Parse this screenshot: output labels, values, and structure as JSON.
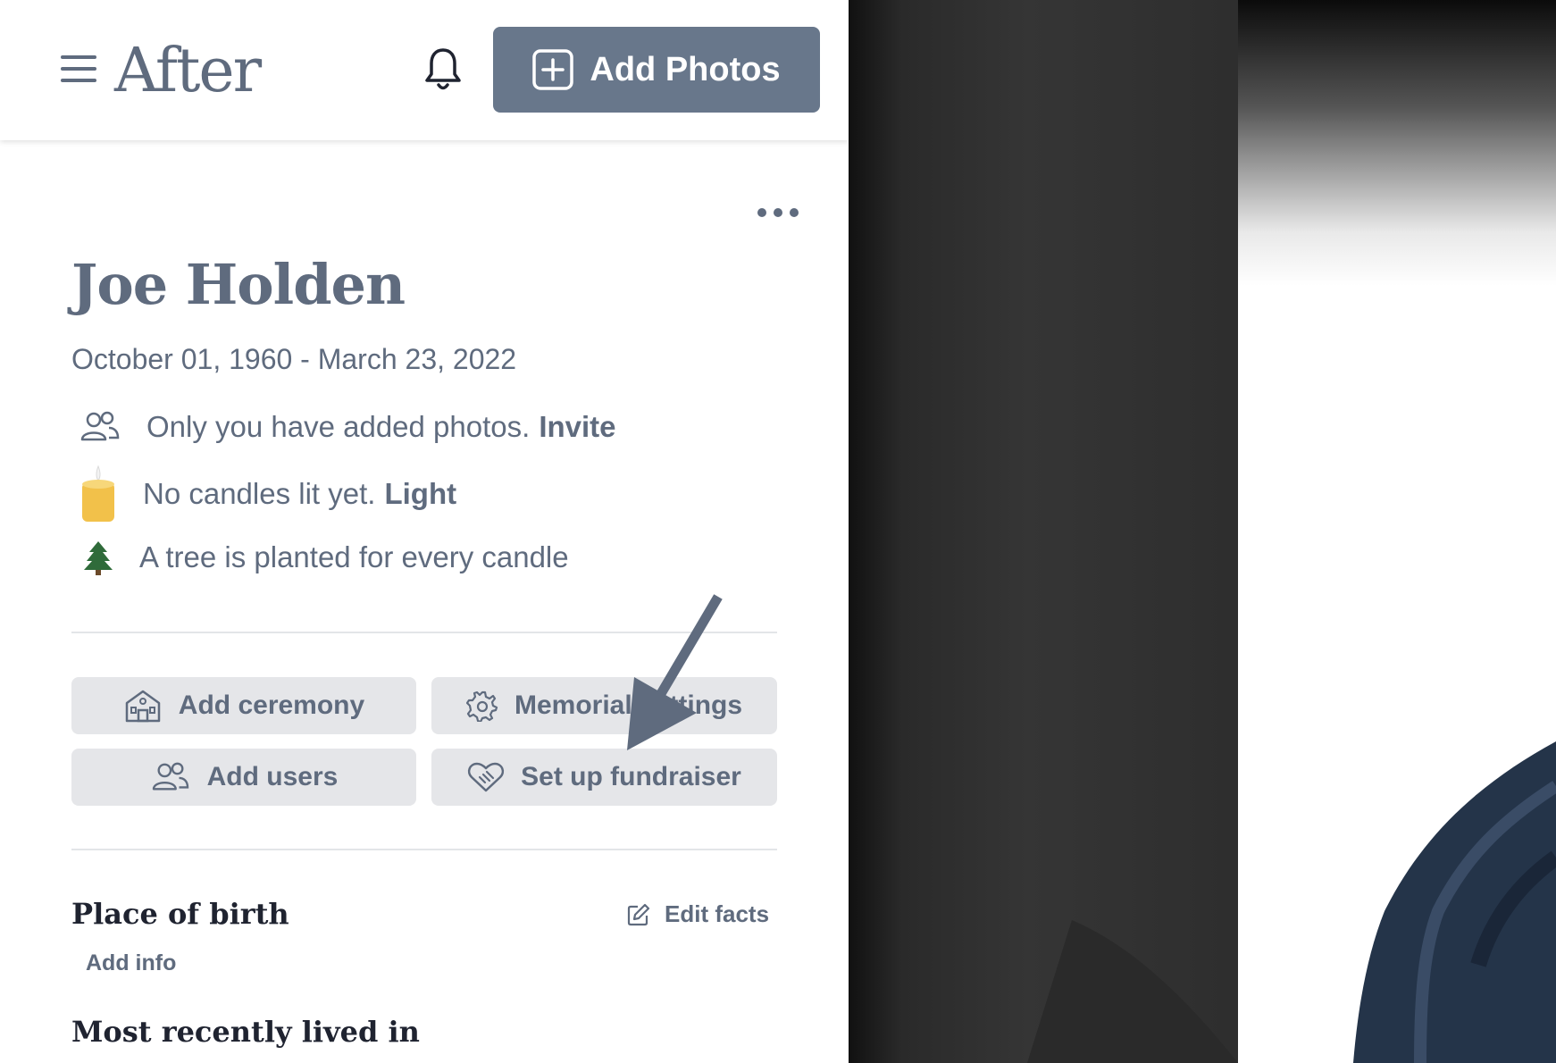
{
  "header": {
    "logo": "After",
    "add_photos_label": "Add Photos"
  },
  "memorial": {
    "name": "Joe Holden",
    "dates": "October 01, 1960 - March 23, 2022"
  },
  "info_rows": {
    "photos_text": "Only you have added photos.",
    "photos_link": "Invite",
    "candles_text": "No candles lit yet.",
    "candles_link": "Light",
    "tree_text": "A tree is planted for every candle"
  },
  "actions": {
    "add_ceremony": "Add ceremony",
    "memorial_settings": "Memorial settings",
    "add_users": "Add users",
    "set_up_fundraiser": "Set up fundraiser"
  },
  "facts": {
    "place_of_birth_title": "Place of birth",
    "edit_facts": "Edit facts",
    "add_info": "Add info",
    "recently_lived_title": "Most recently lived in"
  },
  "icons": {
    "menu": "hamburger-icon",
    "bell": "bell-icon",
    "plus": "plus-square-icon",
    "more": "more-dots-icon",
    "users": "users-icon",
    "candle": "candle-icon",
    "tree": "tree-icon",
    "building": "building-icon",
    "gear": "gear-icon",
    "heart_hand": "heart-handshake-icon",
    "edit": "edit-icon",
    "arrow": "arrow-annotation"
  },
  "colors": {
    "accent": "#68778b",
    "text": "#5f6b7e",
    "button_bg": "#e5e6e9",
    "heading": "#1f2330"
  }
}
